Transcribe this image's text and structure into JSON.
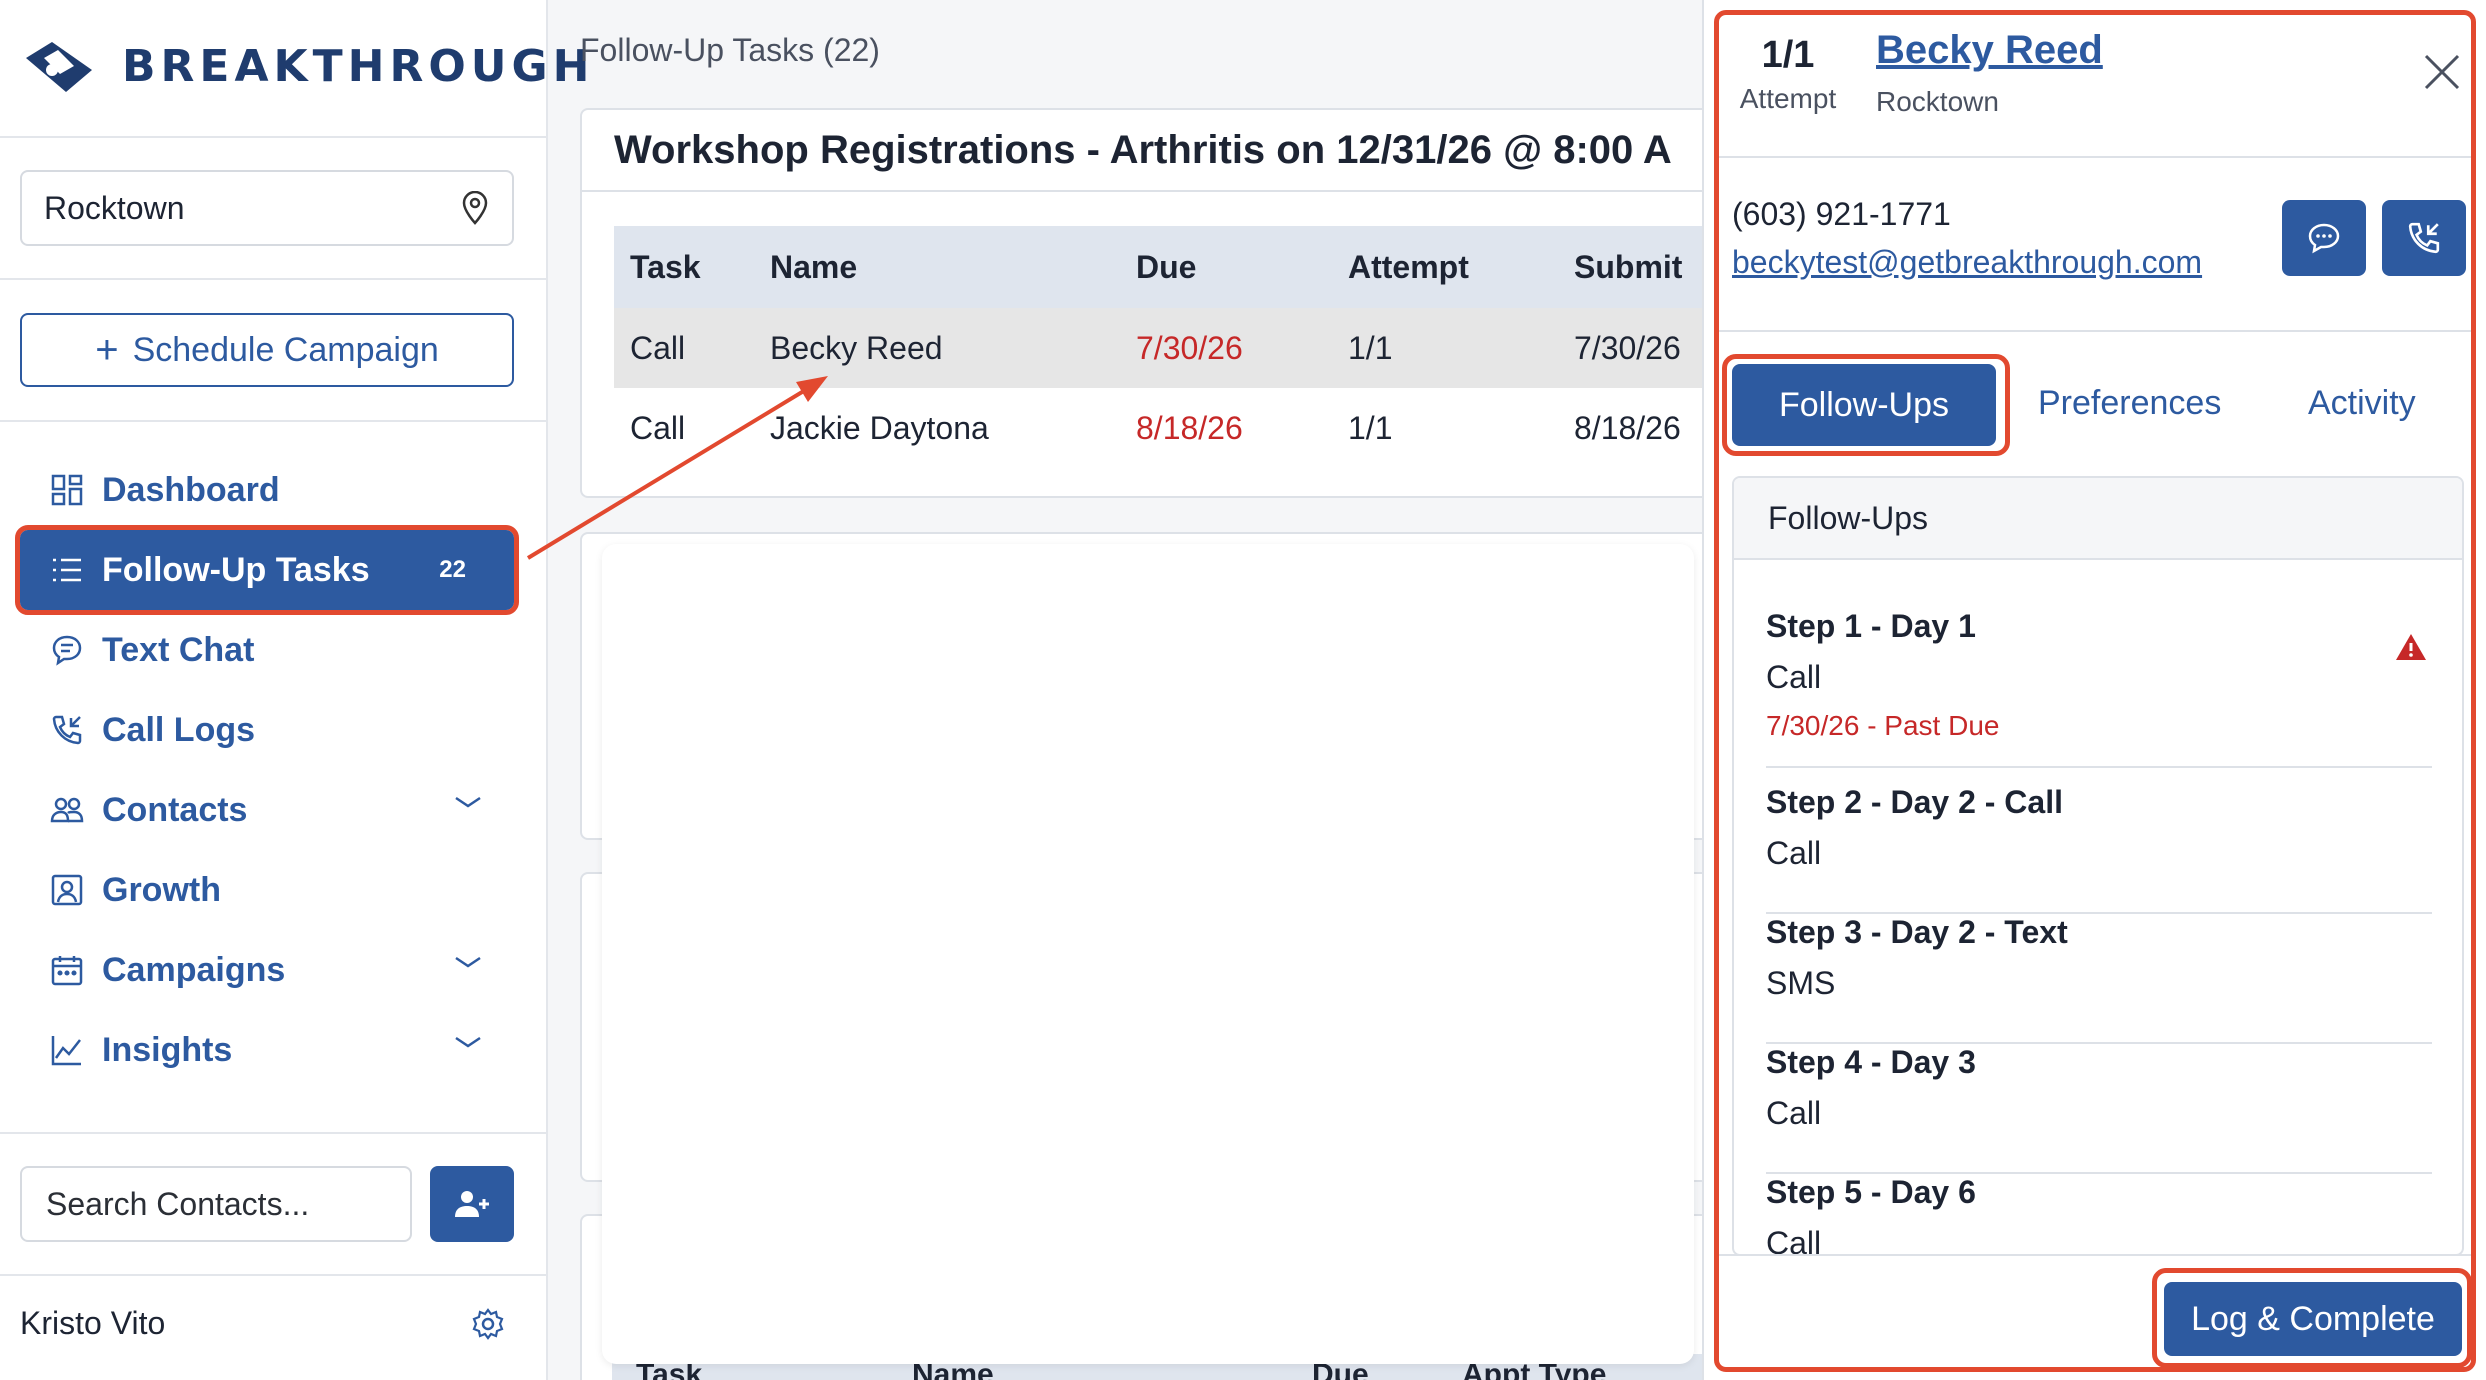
{
  "brand": {
    "name": "BREAKTHROUGH",
    "color": "#1f3c6e",
    "accent": "#2d5aa0",
    "highlight": "#e2492f"
  },
  "sidebar": {
    "location": "Rocktown",
    "schedule_button": "Schedule Campaign",
    "items": [
      {
        "label": "Dashboard",
        "icon": "dashboard-icon"
      },
      {
        "label": "Follow-Up Tasks",
        "icon": "list-icon",
        "badge": "22",
        "active": true
      },
      {
        "label": "Text Chat",
        "icon": "chat-icon"
      },
      {
        "label": "Call Logs",
        "icon": "phone-icon"
      },
      {
        "label": "Contacts",
        "icon": "people-icon",
        "expandable": true
      },
      {
        "label": "Growth",
        "icon": "growth-icon"
      },
      {
        "label": "Campaigns",
        "icon": "calendar-icon",
        "expandable": true
      },
      {
        "label": "Insights",
        "icon": "chart-icon",
        "expandable": true
      }
    ],
    "search_placeholder": "Search Contacts...",
    "user_name": "Kristo Vito"
  },
  "main": {
    "title": "Follow-Up Tasks (22)",
    "card_title": "Workshop Registrations - Arthritis on 12/31/26 @ 8:00 A",
    "columns": [
      "Task",
      "Name",
      "Due",
      "Attempt",
      "Submit"
    ],
    "rows": [
      {
        "task": "Call",
        "name": "Becky Reed",
        "due": "7/30/26",
        "attempt": "1/1",
        "submit": "7/30/26"
      },
      {
        "task": "Call",
        "name": "Jackie Daytona",
        "due": "8/18/26",
        "attempt": "1/1",
        "submit": "8/18/26"
      }
    ],
    "bottom_columns": [
      "Task",
      "Name",
      "Due",
      "Appt Type"
    ]
  },
  "panel": {
    "attempt": "1/1",
    "attempt_label": "Attempt",
    "name": "Becky Reed",
    "location": "Rocktown",
    "phone": "(603) 921-1771",
    "email": "beckytest@getbreakthrough.com",
    "tabs": [
      "Follow-Ups",
      "Preferences",
      "Activity"
    ],
    "section_title": "Follow-Ups",
    "steps": [
      {
        "title": "Step 1 - Day 1",
        "type": "Call",
        "due": "7/30/26 - Past Due",
        "warning": true
      },
      {
        "title": "Step 2 - Day 2 - Call",
        "type": "Call"
      },
      {
        "title": "Step 3 - Day 2 - Text",
        "type": "SMS"
      },
      {
        "title": "Step 4 - Day 3",
        "type": "Call"
      },
      {
        "title": "Step 5 - Day 6",
        "type": "Call"
      }
    ],
    "log_button": "Log & Complete"
  }
}
